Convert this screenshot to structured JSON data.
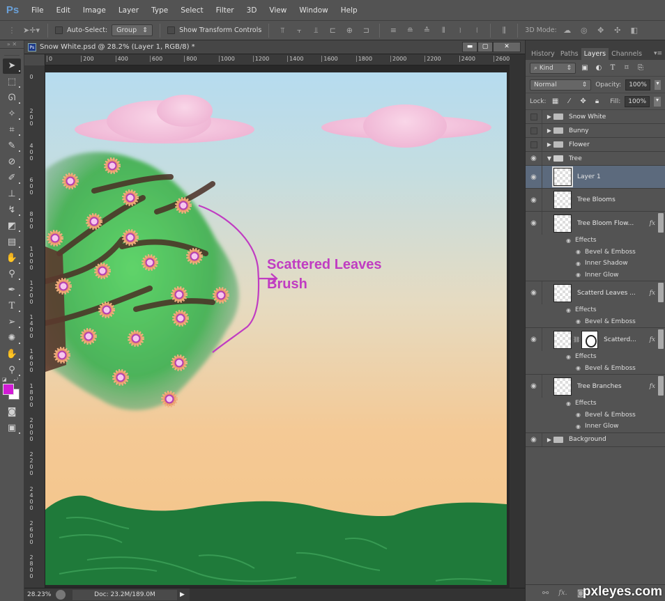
{
  "app": {
    "logo": "Ps"
  },
  "menu": [
    "File",
    "Edit",
    "Image",
    "Layer",
    "Type",
    "Select",
    "Filter",
    "3D",
    "View",
    "Window",
    "Help"
  ],
  "options_bar": {
    "auto_select_label": "Auto-Select:",
    "auto_select_checked": false,
    "auto_select_mode": "Group",
    "show_transform_label": "Show Transform Controls",
    "show_transform_checked": false,
    "three_d_mode_label": "3D Mode:"
  },
  "document": {
    "title": "Snow White.psd @ 28.2% (Layer 1, RGB/8) *",
    "minimize": "▬",
    "maximize": "▢",
    "close": "✕",
    "h_ruler_ticks": [
      "0",
      "200",
      "400",
      "600",
      "800",
      "1000",
      "1200",
      "1400",
      "1600",
      "1800",
      "2000",
      "2200",
      "2400",
      "2600"
    ],
    "v_ruler_ticks": [
      "0",
      "200",
      "400",
      "600",
      "800",
      "1000",
      "1200",
      "1400",
      "1600",
      "1800",
      "2000",
      "2200",
      "2400",
      "2600",
      "2800"
    ]
  },
  "canvas": {
    "annotation_line1": "Scattered Leaves",
    "annotation_line2": "Brush",
    "annotation_color": "#c03cc2"
  },
  "status": {
    "zoom": "28.23%",
    "doc_size": "Doc: 23.2M/189.0M"
  },
  "toolbox": {
    "foreground_color": "#d21bd6",
    "background_color": "#ffffff",
    "tools": [
      "move",
      "marquee",
      "lasso",
      "quick-select",
      "crop",
      "eyedropper",
      "healing-brush",
      "brush",
      "clone-stamp",
      "history-brush",
      "eraser",
      "gradient",
      "blur",
      "dodge",
      "pen",
      "type",
      "path-select",
      "shape",
      "hand",
      "zoom"
    ]
  },
  "panel": {
    "tabs": [
      "History",
      "Paths",
      "Layers",
      "Channels"
    ],
    "active_tab": "Layers",
    "filter_kind": "Kind",
    "blend_mode": "Normal",
    "opacity_label": "Opacity:",
    "opacity": "100%",
    "lock_label": "Lock:",
    "fill_label": "Fill:",
    "fill": "100%",
    "layers": {
      "snow_white": "Snow White",
      "bunny": "Bunny",
      "flower": "Flower",
      "tree": "Tree",
      "layer1": "Layer 1",
      "tree_blooms": "Tree Blooms",
      "tree_bloom_flow": "Tree Bloom Flow...",
      "scattered_leaves": "Scatterd Leaves ...",
      "scattered_masked": "Scatterd...",
      "tree_branches": "Tree Branches",
      "background": "Background"
    },
    "effects_label": "Effects",
    "effect_bevel": "Bevel & Emboss",
    "effect_inner_shadow": "Inner Shadow",
    "effect_inner_glow": "Inner Glow",
    "fx": "fx"
  },
  "watermark": "pxleyes.com"
}
